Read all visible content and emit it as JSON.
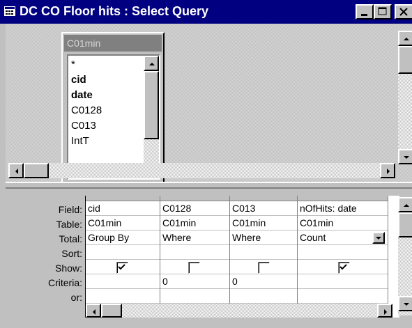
{
  "window": {
    "title": "DC CO Floor hits : Select Query",
    "icon": "query-icon",
    "controls": [
      "minimize-icon",
      "maximize-icon",
      "close-icon"
    ]
  },
  "field_list": {
    "table_name": "C01min",
    "fields": [
      {
        "label": "*",
        "bold": false
      },
      {
        "label": "cid",
        "bold": true
      },
      {
        "label": "date",
        "bold": true
      },
      {
        "label": "C0128",
        "bold": false
      },
      {
        "label": "C013",
        "bold": false
      },
      {
        "label": "IntT",
        "bold": false
      }
    ]
  },
  "grid": {
    "row_labels": [
      "Field:",
      "Table:",
      "Total:",
      "Sort:",
      "Show:",
      "Criteria:",
      "or:"
    ],
    "columns": [
      {
        "field": "cid",
        "table": "C01min",
        "total": "Group By",
        "sort": "",
        "show": true,
        "criteria": "",
        "or": ""
      },
      {
        "field": "C0128",
        "table": "C01min",
        "total": "Where",
        "sort": "",
        "show": false,
        "criteria": "0",
        "or": ""
      },
      {
        "field": "C013",
        "table": "C01min",
        "total": "Where",
        "sort": "",
        "show": false,
        "criteria": "0",
        "or": ""
      },
      {
        "field": "nOfHits: date",
        "table": "C01min",
        "total": "Count",
        "sort": "",
        "show": true,
        "criteria": "",
        "or": ""
      }
    ]
  }
}
